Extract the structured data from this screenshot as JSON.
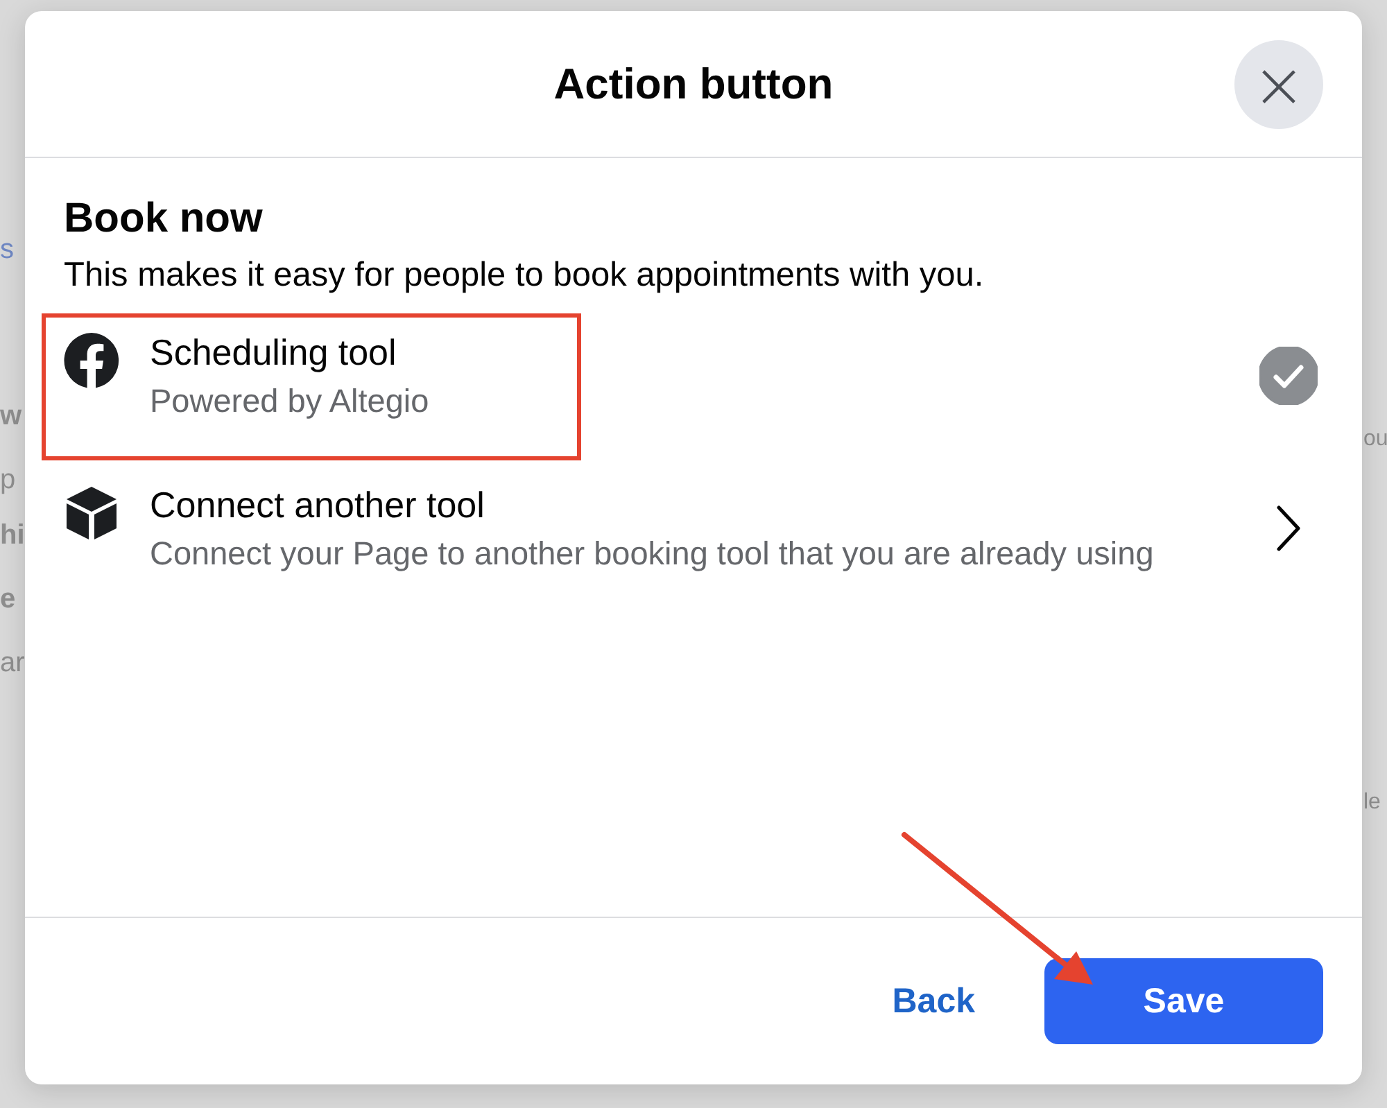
{
  "background": {
    "left_fragments": [
      {
        "kind": "link",
        "text": "s"
      },
      {
        "kind": "bold",
        "text": "w"
      },
      {
        "kind": "plain",
        "text": "p"
      },
      {
        "kind": "bold",
        "text": "hi"
      },
      {
        "kind": "bold",
        "text": "e"
      },
      {
        "kind": "plain",
        "text": "ar"
      }
    ],
    "right_fragments": [
      "ou",
      "le"
    ]
  },
  "dialog": {
    "title": "Action button",
    "close_label": "×"
  },
  "section": {
    "heading": "Book now",
    "description": "This makes it easy for people to book appointments with you."
  },
  "options": [
    {
      "kind": "check",
      "title": "Scheduling tool",
      "subtitle": "Powered by Altegio",
      "selected": true,
      "highlighted": true
    },
    {
      "kind": "chevron",
      "title": "Connect another tool",
      "subtitle": "Connect your Page to another booking tool that you are already using",
      "selected": false,
      "highlighted": false
    }
  ],
  "footer": {
    "back": "Back",
    "save": "Save",
    "save_pointed": true
  }
}
